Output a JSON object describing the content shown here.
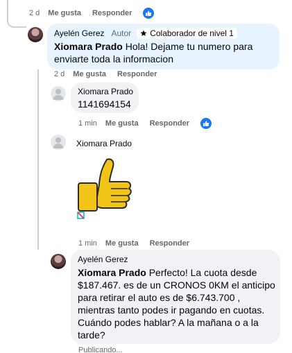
{
  "top_meta": {
    "time": "2 d",
    "like": "Me gusta",
    "reply": "Responder"
  },
  "comment1": {
    "author": "Ayelén Gerez",
    "role": "Autor",
    "badge": "Colaborador de nivel 1",
    "mention": "Xiomara Prado",
    "text_rest": "Hola! Dejame tu numero para",
    "text_line2": "enviarte toda la informacion",
    "meta": {
      "time": "2 d",
      "like": "Me gusta",
      "reply": "Responder"
    }
  },
  "reply1": {
    "author": "Xiomara Prado",
    "text": "1141694154",
    "meta": {
      "time": "1 min",
      "like": "Me gusta",
      "reply": "Responder"
    }
  },
  "reply2": {
    "author": "Xiomara Prado",
    "sticker": "thumbs-up",
    "meta": {
      "time": "1 min",
      "like": "Me gusta",
      "reply": "Responder"
    }
  },
  "reply3": {
    "author": "Ayelén Gerez",
    "mention": "Xiomara Prado",
    "line1": "Perfecto! La cuota desde",
    "line2": "$187.467. es de un CRONOS 0KM el anticipo",
    "line3": "para retirar el auto es de $6.743.700 ,",
    "line4": "mientras tanto podes ir pagando en cuotas.",
    "line5": "Cuándo podes hablar? A la mañana o a la",
    "line6": "tarde?",
    "status": "Publicando..."
  },
  "colors": {
    "accent": "#1877f2",
    "bubble": "#f0f2f5",
    "highlight": "#e7f3ff",
    "muted": "#65676b"
  }
}
